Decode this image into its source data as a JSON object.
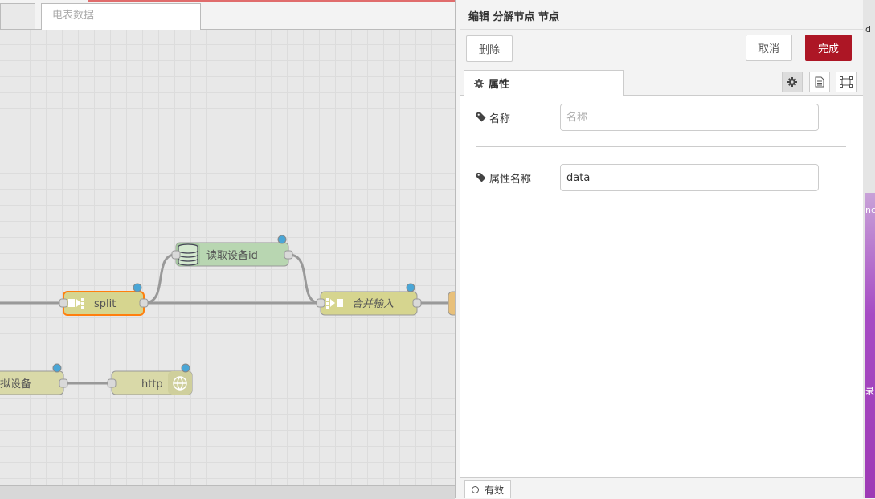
{
  "workspace": {
    "tabs": [
      {
        "label": ""
      },
      {
        "label": "电表数据"
      }
    ],
    "nodes": {
      "db": "读取设备id",
      "split": "split",
      "join": "合并输入",
      "device": "拟设备",
      "http": "http"
    }
  },
  "editor": {
    "title": "编辑 分解节点 节点",
    "delete_label": "删除",
    "cancel_label": "取消",
    "done_label": "完成",
    "properties_tab": "属性",
    "name_label": "名称",
    "name_placeholder": "名称",
    "name_value": "",
    "property_label": "属性名称",
    "property_value": "data",
    "status_label": "有效"
  },
  "side_strip": [
    "d",
    "nc",
    "录"
  ],
  "colors": {
    "primary": "#ad1625",
    "db_node": "#b8d6b1",
    "function_node": "#d6d58f",
    "selected_border": "#ff7f0e",
    "port_dot": "#4aa6d6"
  }
}
